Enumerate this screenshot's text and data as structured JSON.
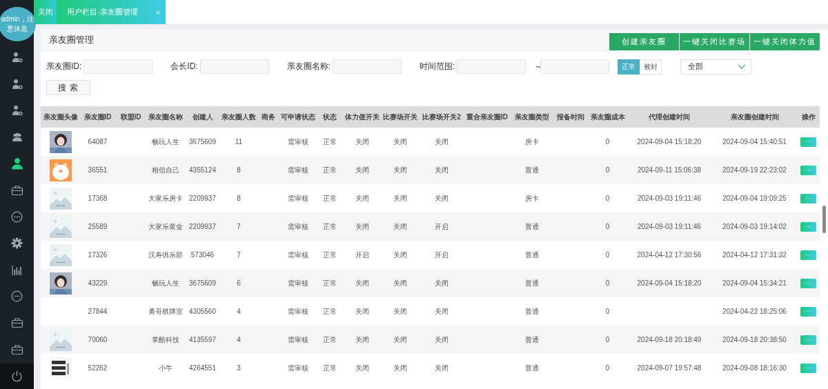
{
  "sidebar": {
    "user_badge": "admin，注意休息",
    "items": [
      {
        "kind": "user-gear",
        "selected": false
      },
      {
        "kind": "user-gear",
        "selected": false
      },
      {
        "kind": "user-gear",
        "selected": false
      },
      {
        "kind": "group",
        "selected": false
      },
      {
        "kind": "user",
        "selected": true
      },
      {
        "kind": "bag",
        "selected": false
      },
      {
        "kind": "chat",
        "selected": false
      },
      {
        "kind": "gear",
        "selected": false
      },
      {
        "kind": "chart",
        "selected": false
      },
      {
        "kind": "chat",
        "selected": false
      },
      {
        "kind": "bag",
        "selected": false
      },
      {
        "kind": "bag",
        "selected": false
      }
    ]
  },
  "tabs": {
    "close_all": "关闭",
    "items": [
      {
        "label": "用户栏目-亲友圈管理",
        "selected": true,
        "close": "×"
      }
    ]
  },
  "panel": {
    "title": "亲友圈管理",
    "buttons": [
      "创建亲友圈",
      "一键关闭比赛场",
      "一键关闭体力值"
    ]
  },
  "filters": {
    "fields": [
      {
        "label": "亲友圈ID:"
      },
      {
        "label": "会长ID:"
      },
      {
        "label": "亲友圈名称:"
      },
      {
        "label": "时间范围:"
      }
    ],
    "range_sep": "~",
    "status_toggle": [
      {
        "label": "正常",
        "selected": true
      },
      {
        "label": "被封",
        "selected": false
      }
    ],
    "select": {
      "value": "全部"
    },
    "search_button": "搜 索"
  },
  "table": {
    "avatar_header": "亲友圈头像",
    "columns": [
      "亲友圈ID",
      "联盟ID",
      "亲友圈名称",
      "创建人",
      "亲友圈人数",
      "商务",
      "可申请状态",
      "状态",
      "体力值开关",
      "比赛场开关",
      "比赛场开关2",
      "重合亲友圈ID",
      "亲友圈类型",
      "报备时间",
      "亲友圈成本",
      "代理创建时间",
      "亲友圈创建时间",
      "操作"
    ],
    "rows": [
      {
        "avatar": {
          "kind": "picture"
        },
        "cells": [
          "64087",
          "",
          "畅玩人生",
          "3675609",
          "11",
          "",
          "需审核",
          "正常",
          "关闭",
          "关闭",
          "关闭",
          "",
          "房卡",
          "",
          "0",
          "2024-09-04 15:18:20",
          "2024-09-04 15:40:51"
        ],
        "action": "···"
      },
      {
        "avatar": {
          "kind": "picture"
        },
        "cells": [
          "36551",
          "",
          "相信自己",
          "4355124",
          "8",
          "",
          "需审核",
          "正常",
          "关闭",
          "关闭",
          "关闭",
          "",
          "普通",
          "",
          "0",
          "2024-09-11 15:06:38",
          "2024-09-19 22:23:02"
        ],
        "action": "···"
      },
      {
        "avatar": {
          "kind": "picture"
        },
        "cells": [
          "17368",
          "",
          "大家乐房卡",
          "2209937",
          "8",
          "",
          "需审核",
          "正常",
          "关闭",
          "关闭",
          "关闭",
          "",
          "房卡",
          "",
          "0",
          "2024-09-03 19:11:46",
          "2024-09-04 19:09:25"
        ],
        "action": "···"
      },
      {
        "avatar": {
          "kind": "picture"
        },
        "cells": [
          "25589",
          "",
          "大家乐黄金",
          "2209937",
          "7",
          "",
          "需审核",
          "正常",
          "关闭",
          "关闭",
          "开启",
          "",
          "普通",
          "",
          "0",
          "2024-09-03 19:11:46",
          "2024-09-03 19:14:02"
        ],
        "action": "···"
      },
      {
        "avatar": {
          "kind": "picture"
        },
        "cells": [
          "17326",
          "",
          "汉寿俱乐部",
          "573046",
          "7",
          "",
          "需审核",
          "正常",
          "开启",
          "关闭",
          "开启",
          "",
          "普通",
          "",
          "0",
          "2024-04-12 17:30:56",
          "2024-04-12 17:31:32"
        ],
        "action": "···"
      },
      {
        "avatar": {
          "kind": "picture"
        },
        "cells": [
          "43229",
          "",
          "畅玩人生",
          "3675609",
          "6",
          "",
          "需审核",
          "正常",
          "关闭",
          "关闭",
          "关闭",
          "",
          "普通",
          "",
          "0",
          "2024-09-04 15:18:20",
          "2024-09-04 15:34:21"
        ],
        "action": "···"
      },
      {
        "cells": [
          "27844",
          "",
          "勇哥棋牌室",
          "4305560",
          "4",
          "",
          "需审核",
          "正常",
          "关闭",
          "关闭",
          "关闭",
          "",
          "普通",
          "",
          "0",
          "",
          "2024-04-22 18:25:06"
        ],
        "action": "···"
      },
      {
        "avatar": {
          "kind": "picture"
        },
        "cells": [
          "70060",
          "",
          "掌酷科技",
          "4135597",
          "4",
          "",
          "需审核",
          "正常",
          "关闭",
          "关闭",
          "关闭",
          "",
          "普通",
          "",
          "0",
          "2024-09-18 20:18:49",
          "2024-09-18 20:38:50"
        ],
        "action": "···"
      },
      {
        "avatar": {
          "kind": "picture"
        },
        "cells": [
          "52262",
          "",
          "小牛",
          "4264551",
          "3",
          "",
          "需审核",
          "正常",
          "关闭",
          "关闭",
          "关闭",
          "",
          "普通",
          "",
          "0",
          "2024-09-07 19:57:48",
          "2024-09-08 18:16:30"
        ],
        "action": "···"
      }
    ]
  }
}
